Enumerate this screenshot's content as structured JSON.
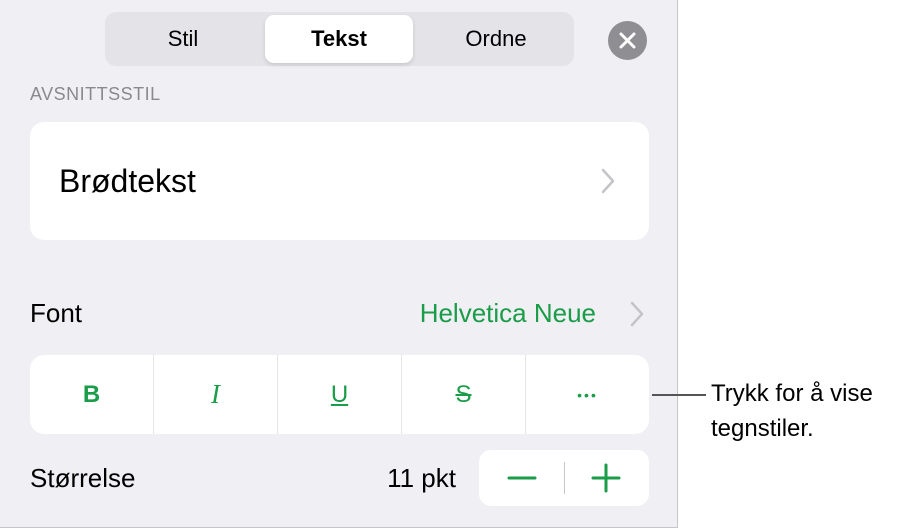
{
  "tabs": [
    {
      "label": "Stil"
    },
    {
      "label": "Tekst"
    },
    {
      "label": "Ordne"
    }
  ],
  "paragraph_style": {
    "section_label": "AVSNITTSSTIL",
    "value": "Brødtekst"
  },
  "font": {
    "label": "Font",
    "value": "Helvetica Neue"
  },
  "format_buttons": {
    "bold": "B",
    "italic": "I",
    "underline": "U",
    "strikethrough": "S",
    "more": "•••"
  },
  "size": {
    "label": "Størrelse",
    "value": "11 pkt"
  },
  "callout": {
    "line1": "Trykk for å vise",
    "line2": "tegnstiler."
  },
  "colors": {
    "accent": "#1a9c48",
    "panel_bg": "#efeff4",
    "secondary_text": "#8a8a8e"
  }
}
